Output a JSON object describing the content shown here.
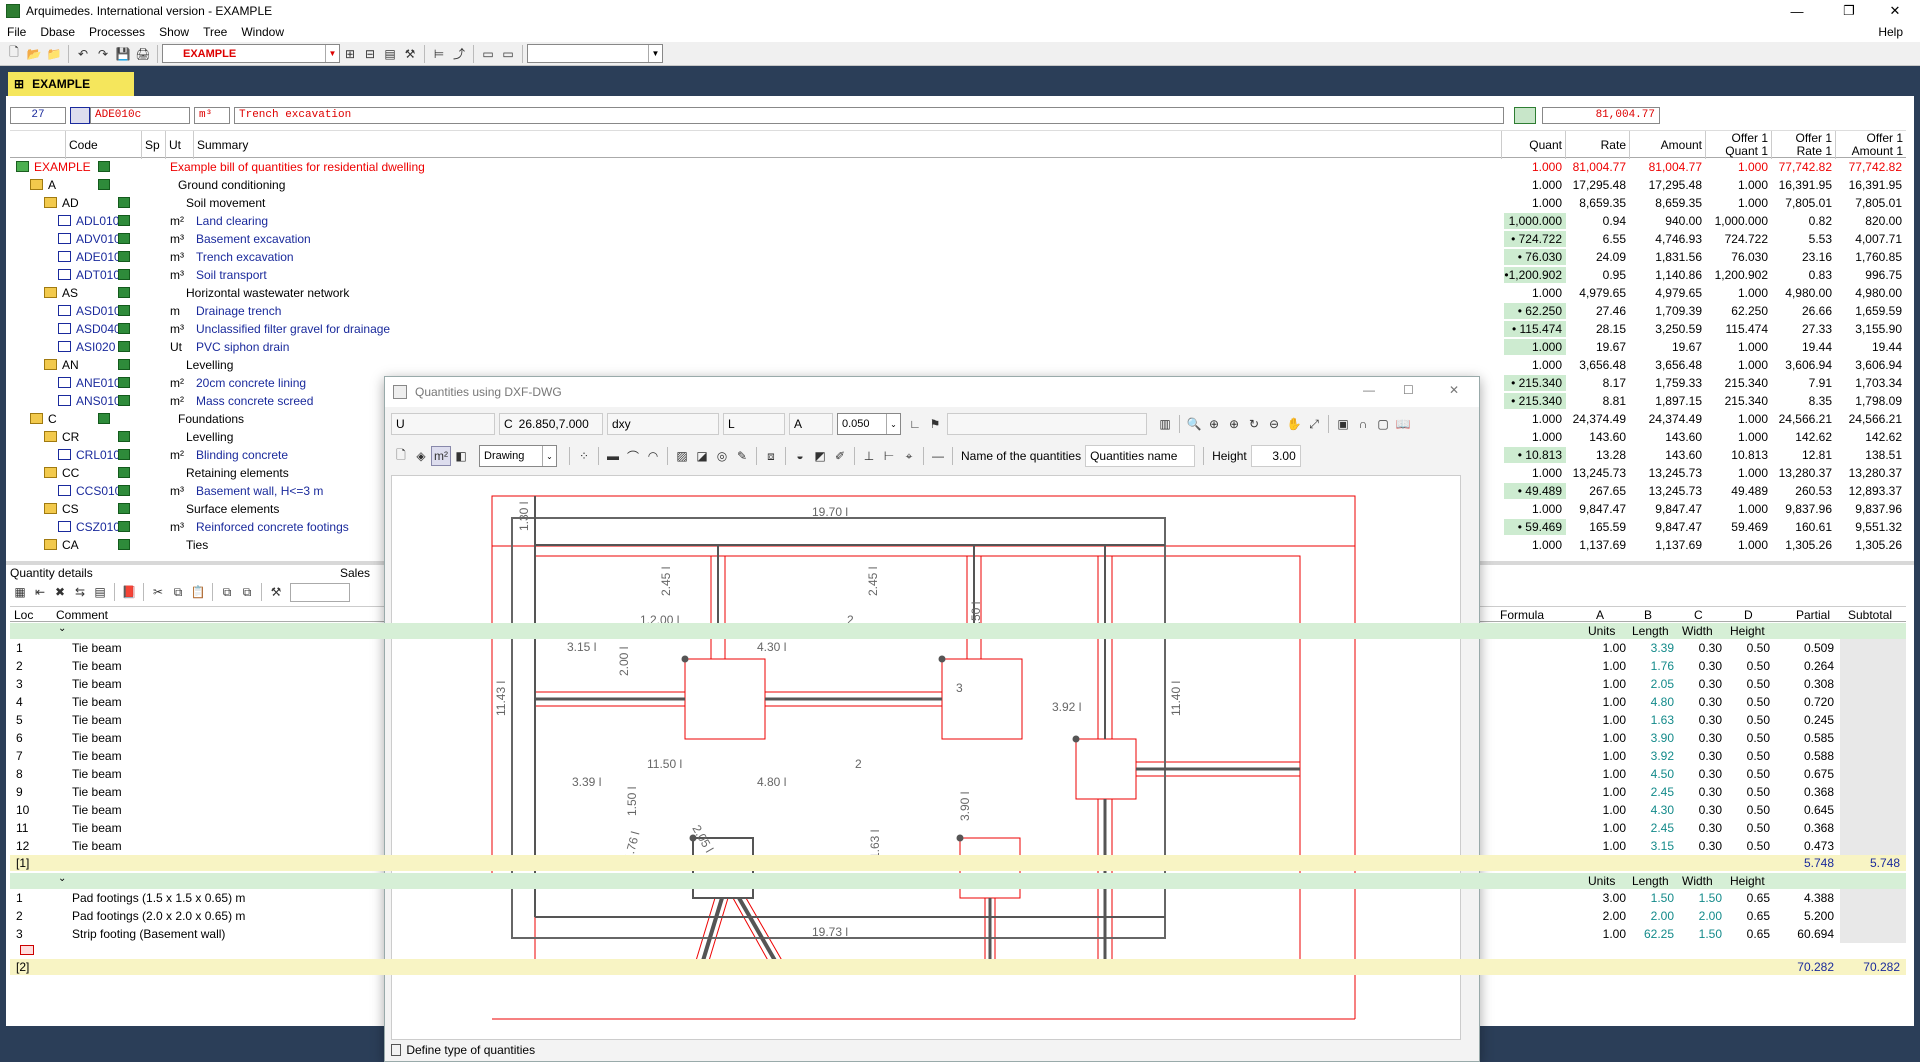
{
  "window": {
    "title": "Arquimedes. International version - EXAMPLE",
    "minimize": "—",
    "maximize": "❐",
    "close": "✕"
  },
  "menu": {
    "items": [
      "File",
      "Dbase",
      "Processes",
      "Show",
      "Tree",
      "Window"
    ],
    "help": "Help"
  },
  "toolbar": {
    "project_combo": "EXAMPLE",
    "empty_combo": ""
  },
  "project_tab": "EXAMPLE",
  "codebar": {
    "number": "27",
    "code": "ADE010c",
    "unit": "m³",
    "summary": "Trench excavation",
    "amount": "81,004.77"
  },
  "columns": {
    "code": "Code",
    "sp": "Sp",
    "ut": "Ut",
    "summary": "Summary",
    "quant": "Quant",
    "rate": "Rate",
    "amount": "Amount",
    "offer_quant": "Offer 1 Quant 1",
    "offer_rate": "Offer 1 Rate 1",
    "offer_amount": "Offer 1 Amount 1"
  },
  "rows": [
    {
      "level": 0,
      "type": "root",
      "code": "EXAMPLE",
      "ut": "",
      "summary": "Example bill of quantities for residential dwelling",
      "quant": "1.000",
      "rate": "81,004.77",
      "amount": "81,004.77",
      "oq": "1.000",
      "or": "77,742.82",
      "oa": "77,742.82",
      "red": true
    },
    {
      "level": 1,
      "type": "folder",
      "code": "A",
      "ut": "",
      "summary": "Ground conditioning",
      "quant": "1.000",
      "rate": "17,295.48",
      "amount": "17,295.48",
      "oq": "1.000",
      "or": "16,391.95",
      "oa": "16,391.95"
    },
    {
      "level": 2,
      "type": "folder",
      "code": "AD",
      "ut": "",
      "summary": "Soil movement",
      "quant": "1.000",
      "rate": "8,659.35",
      "amount": "8,659.35",
      "oq": "1.000",
      "or": "7,805.01",
      "oa": "7,805.01"
    },
    {
      "level": 3,
      "type": "item",
      "code": "ADL010",
      "ut": "m²",
      "summary": "Land clearing",
      "quant": "1,000.000",
      "rate": "0.94",
      "amount": "940.00",
      "oq": "1,000.000",
      "or": "0.82",
      "oa": "820.00",
      "hl": true
    },
    {
      "level": 3,
      "type": "item",
      "code": "ADV010",
      "ut": "m³",
      "summary": "Basement excavation",
      "quant": "• 724.722",
      "rate": "6.55",
      "amount": "4,746.93",
      "oq": "724.722",
      "or": "5.53",
      "oa": "4,007.71",
      "hl": true
    },
    {
      "level": 3,
      "type": "item",
      "code": "ADE010c",
      "ut": "m³",
      "summary": "Trench excavation",
      "quant": "• 76.030",
      "rate": "24.09",
      "amount": "1,831.56",
      "oq": "76.030",
      "or": "23.16",
      "oa": "1,760.85",
      "hl": true
    },
    {
      "level": 3,
      "type": "item",
      "code": "ADT010",
      "ut": "m³",
      "summary": "Soil transport",
      "quant": "•1,200.902",
      "rate": "0.95",
      "amount": "1,140.86",
      "oq": "1,200.902",
      "or": "0.83",
      "oa": "996.75",
      "hl": true
    },
    {
      "level": 2,
      "type": "folder",
      "code": "AS",
      "ut": "",
      "summary": "Horizontal wastewater network",
      "quant": "1.000",
      "rate": "4,979.65",
      "amount": "4,979.65",
      "oq": "1.000",
      "or": "4,980.00",
      "oa": "4,980.00"
    },
    {
      "level": 3,
      "type": "item",
      "code": "ASD010",
      "ut": "m",
      "summary": "Drainage trench",
      "quant": "• 62.250",
      "rate": "27.46",
      "amount": "1,709.39",
      "oq": "62.250",
      "or": "26.66",
      "oa": "1,659.59",
      "hl": true
    },
    {
      "level": 3,
      "type": "item",
      "code": "ASD040",
      "ut": "m³",
      "summary": "Unclassified filter gravel for drainage",
      "quant": "• 115.474",
      "rate": "28.15",
      "amount": "3,250.59",
      "oq": "115.474",
      "or": "27.33",
      "oa": "3,155.90",
      "hl": true
    },
    {
      "level": 3,
      "type": "item",
      "code": "ASI020",
      "ut": "Ut",
      "summary": "PVC siphon drain",
      "quant": "1.000",
      "rate": "19.67",
      "amount": "19.67",
      "oq": "1.000",
      "or": "19.44",
      "oa": "19.44",
      "hl": true
    },
    {
      "level": 2,
      "type": "folder",
      "code": "AN",
      "ut": "",
      "summary": "Levelling",
      "quant": "1.000",
      "rate": "3,656.48",
      "amount": "3,656.48",
      "oq": "1.000",
      "or": "3,606.94",
      "oa": "3,606.94"
    },
    {
      "level": 3,
      "type": "item",
      "code": "ANE010",
      "ut": "m²",
      "summary": "20cm concrete lining",
      "quant": "• 215.340",
      "rate": "8.17",
      "amount": "1,759.33",
      "oq": "215.340",
      "or": "7.91",
      "oa": "1,703.34",
      "hl": true
    },
    {
      "level": 3,
      "type": "item",
      "code": "ANS010",
      "ut": "m²",
      "summary": "Mass concrete screed",
      "quant": "• 215.340",
      "rate": "8.81",
      "amount": "1,897.15",
      "oq": "215.340",
      "or": "8.35",
      "oa": "1,798.09",
      "hl": true
    },
    {
      "level": 1,
      "type": "folder",
      "code": "C",
      "ut": "",
      "summary": "Foundations",
      "quant": "1.000",
      "rate": "24,374.49",
      "amount": "24,374.49",
      "oq": "1.000",
      "or": "24,566.21",
      "oa": "24,566.21"
    },
    {
      "level": 2,
      "type": "folder",
      "code": "CR",
      "ut": "",
      "summary": "Levelling",
      "quant": "1.000",
      "rate": "143.60",
      "amount": "143.60",
      "oq": "1.000",
      "or": "142.62",
      "oa": "142.62"
    },
    {
      "level": 3,
      "type": "item",
      "code": "CRL010",
      "ut": "m²",
      "summary": "Blinding concrete",
      "quant": "• 10.813",
      "rate": "13.28",
      "amount": "143.60",
      "oq": "10.813",
      "or": "12.81",
      "oa": "138.51",
      "hl": true
    },
    {
      "level": 2,
      "type": "folder",
      "code": "CC",
      "ut": "",
      "summary": "Retaining elements",
      "quant": "1.000",
      "rate": "13,245.73",
      "amount": "13,245.73",
      "oq": "1.000",
      "or": "13,280.37",
      "oa": "13,280.37"
    },
    {
      "level": 3,
      "type": "item",
      "code": "CCS010",
      "ut": "m³",
      "summary": "Basement wall, H<=3 m",
      "quant": "• 49.489",
      "rate": "267.65",
      "amount": "13,245.73",
      "oq": "49.489",
      "or": "260.53",
      "oa": "12,893.37",
      "hl": true
    },
    {
      "level": 2,
      "type": "folder",
      "code": "CS",
      "ut": "",
      "summary": "Surface elements",
      "quant": "1.000",
      "rate": "9,847.47",
      "amount": "9,847.47",
      "oq": "1.000",
      "or": "9,837.96",
      "oa": "9,837.96"
    },
    {
      "level": 3,
      "type": "item",
      "code": "CSZ010",
      "ut": "m³",
      "summary": "Reinforced concrete footings",
      "quant": "• 59.469",
      "rate": "165.59",
      "amount": "9,847.47",
      "oq": "59.469",
      "or": "160.61",
      "oa": "9,551.32",
      "hl": true
    },
    {
      "level": 2,
      "type": "folder",
      "code": "CA",
      "ut": "",
      "summary": "Ties",
      "quant": "1.000",
      "rate": "1,137.69",
      "amount": "1,137.69",
      "oq": "1.000",
      "or": "1,305.26",
      "oa": "1,305.26"
    }
  ],
  "quantity_details": {
    "title": "Quantity details",
    "sales_label": "Sales",
    "headers": {
      "loc": "Loc",
      "comment": "Comment",
      "formula": "Formula",
      "a": "A",
      "b": "B",
      "c": "C",
      "d": "D",
      "partial": "Partial",
      "subtotal": "Subtotal"
    },
    "sub_headers": {
      "units": "Units",
      "length": "Length",
      "width": "Width",
      "height": "Height"
    },
    "group1": [
      {
        "loc": "1",
        "comment": "Tie beam",
        "units": "1.00",
        "length": "3.39",
        "width": "0.30",
        "height": "0.50",
        "partial": "0.509"
      },
      {
        "loc": "2",
        "comment": "Tie beam",
        "units": "1.00",
        "length": "1.76",
        "width": "0.30",
        "height": "0.50",
        "partial": "0.264"
      },
      {
        "loc": "3",
        "comment": "Tie beam",
        "units": "1.00",
        "length": "2.05",
        "width": "0.30",
        "height": "0.50",
        "partial": "0.308"
      },
      {
        "loc": "4",
        "comment": "Tie beam",
        "units": "1.00",
        "length": "4.80",
        "width": "0.30",
        "height": "0.50",
        "partial": "0.720"
      },
      {
        "loc": "5",
        "comment": "Tie beam",
        "units": "1.00",
        "length": "1.63",
        "width": "0.30",
        "height": "0.50",
        "partial": "0.245"
      },
      {
        "loc": "6",
        "comment": "Tie beam",
        "units": "1.00",
        "length": "3.90",
        "width": "0.30",
        "height": "0.50",
        "partial": "0.585"
      },
      {
        "loc": "7",
        "comment": "Tie beam",
        "units": "1.00",
        "length": "3.92",
        "width": "0.30",
        "height": "0.50",
        "partial": "0.588"
      },
      {
        "loc": "8",
        "comment": "Tie beam",
        "units": "1.00",
        "length": "4.50",
        "width": "0.30",
        "height": "0.50",
        "partial": "0.675"
      },
      {
        "loc": "9",
        "comment": "Tie beam",
        "units": "1.00",
        "length": "2.45",
        "width": "0.30",
        "height": "0.50",
        "partial": "0.368"
      },
      {
        "loc": "10",
        "comment": "Tie beam",
        "units": "1.00",
        "length": "4.30",
        "width": "0.30",
        "height": "0.50",
        "partial": "0.645"
      },
      {
        "loc": "11",
        "comment": "Tie beam",
        "units": "1.00",
        "length": "2.45",
        "width": "0.30",
        "height": "0.50",
        "partial": "0.368"
      },
      {
        "loc": "12",
        "comment": "Tie beam",
        "units": "1.00",
        "length": "3.15",
        "width": "0.30",
        "height": "0.50",
        "partial": "0.473"
      }
    ],
    "group1_total": {
      "label": "[1]",
      "partial": "5.748",
      "subtotal": "5.748"
    },
    "group2": [
      {
        "loc": "1",
        "comment": "Pad footings (1.5 x 1.5 x 0.65) m",
        "units": "3.00",
        "length": "1.50",
        "width": "1.50",
        "height": "0.65",
        "partial": "4.388"
      },
      {
        "loc": "2",
        "comment": "Pad footings (2.0 x 2.0 x 0.65) m",
        "units": "2.00",
        "length": "2.00",
        "width": "2.00",
        "height": "0.65",
        "partial": "5.200"
      },
      {
        "loc": "3",
        "comment": "Strip footing (Basement wall)",
        "units": "1.00",
        "length": "62.25",
        "width": "1.50",
        "height": "0.65",
        "partial": "60.694"
      }
    ],
    "group2_total": {
      "label": "[2]",
      "partial": "70.282",
      "subtotal": "70.282"
    }
  },
  "dialog": {
    "title": "Quantities using DXF-DWG",
    "u_label": "U",
    "c_label": "C",
    "c_value": "26.850,7.000",
    "dxy_label": "dxy",
    "l_label": "L",
    "a_label": "A",
    "a_value": "0.050",
    "mode": "Drawing",
    "name_label": "Name of the quantities",
    "name_value": "Quantities name",
    "height_label": "Height",
    "height_value": "3.00",
    "status": "Define type of quantities",
    "drawing_labels": {
      "top": "19.70 l",
      "bottom": "19.73 l",
      "left": "11.43 l",
      "right": "11.40 l",
      "corner": "1.30 l",
      "v1": "2.45 l",
      "v2": "2.45 l",
      "v3": "4.50 l",
      "h1": "3.15 l",
      "h2": "4.30 l",
      "h3": "3.92 l",
      "h4": "3.39 l",
      "h5": "4.80 l",
      "v4": "3.90 l",
      "p1": "1.2.00 l",
      "p2": "2",
      "p3": "3",
      "p4": "11.50 l",
      "p5": "2",
      "s1": "2.00 l",
      "s2": "1.50 l",
      "s3": "1.76 l",
      "s4": "2.05 l",
      "s5": "1.63 l"
    }
  }
}
